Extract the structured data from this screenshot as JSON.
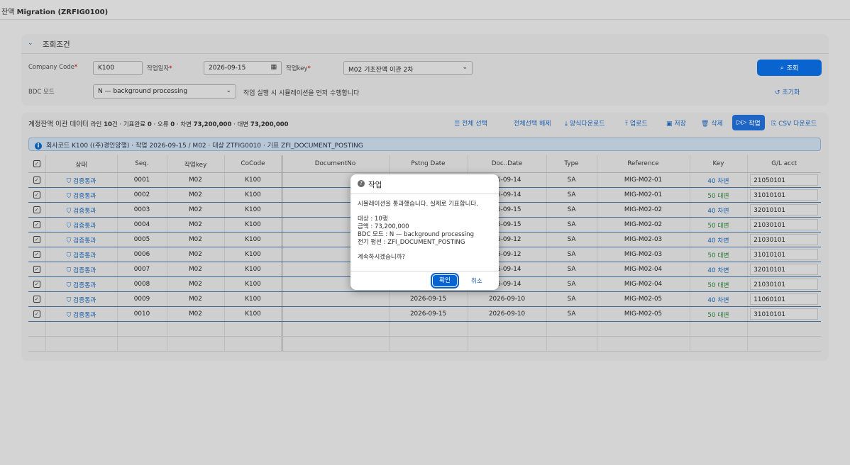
{
  "app": {
    "title_prefix": "잔액",
    "title_main": "Migration (ZRFIG0100)"
  },
  "filter": {
    "section_title": "조회조건",
    "company_code_label": "Company Code",
    "company_code_value": "K100",
    "work_date_label": "작업일자",
    "work_date_value": "2026-09-15",
    "work_key_label": "작업key",
    "work_key_value": "M02 기초잔액 이관 2차",
    "bdc_label": "BDC 모드",
    "bdc_value": "N — background processing",
    "note": "작업 실행 시 시뮬레이션을 먼저 수행합니다",
    "search_button": "조회",
    "reset_button": "초기화"
  },
  "table_bar": {
    "title": "계정잔액 이관 데이터",
    "sub_prefix": "라인",
    "lines": "10",
    "sub_mid1": "건 · 기표완료",
    "done": "0",
    "sub_mid2": "· 오류",
    "errors": "0",
    "sub_mid3": "· 차변",
    "debit": "73,200,000",
    "sub_mid4": "· 대변",
    "credit": "73,200,000",
    "select_all": "전체 선택",
    "deselect_all": "전체선택 해제",
    "download_template": "양식다운로드",
    "upload": "업로드",
    "save": "저장",
    "delete": "삭제",
    "execute": "작업",
    "csv_download": "CSV 다운로드"
  },
  "info": "회사코드 K100 ((주)경인앙행) · 작업 2026-09-15 / M02 · 대상 ZTFIG0010 · 기표 ZFI_DOCUMENT_POSTING",
  "columns": [
    "상태",
    "Seq.",
    "작업key",
    "CoCode",
    "DocumentNo",
    "Pstng Date",
    "Doc..Date",
    "Type",
    "Reference",
    "Key",
    "G/L acct"
  ],
  "rows": [
    {
      "status": "검증통과",
      "seq": "0001",
      "key": "M02",
      "co": "K100",
      "doc": "",
      "pdate": "",
      "ddate": "26-09-14",
      "type": "SA",
      "ref": "MIG-M02-01",
      "pk": "40 차변",
      "pkc": "k40",
      "gl": "21050101"
    },
    {
      "status": "검증통과",
      "seq": "0002",
      "key": "M02",
      "co": "K100",
      "doc": "",
      "pdate": "",
      "ddate": "26-09-14",
      "type": "SA",
      "ref": "MIG-M02-01",
      "pk": "50 대변",
      "pkc": "k50",
      "gl": "31010101"
    },
    {
      "status": "검증통과",
      "seq": "0003",
      "key": "M02",
      "co": "K100",
      "doc": "",
      "pdate": "",
      "ddate": "26-09-15",
      "type": "SA",
      "ref": "MIG-M02-02",
      "pk": "40 차변",
      "pkc": "k40",
      "gl": "32010101"
    },
    {
      "status": "검증통과",
      "seq": "0004",
      "key": "M02",
      "co": "K100",
      "doc": "",
      "pdate": "",
      "ddate": "26-09-15",
      "type": "SA",
      "ref": "MIG-M02-02",
      "pk": "50 대변",
      "pkc": "k50",
      "gl": "21030101"
    },
    {
      "status": "검증통과",
      "seq": "0005",
      "key": "M02",
      "co": "K100",
      "doc": "",
      "pdate": "",
      "ddate": "26-09-12",
      "type": "SA",
      "ref": "MIG-M02-03",
      "pk": "40 차변",
      "pkc": "k40",
      "gl": "21030101"
    },
    {
      "status": "검증통과",
      "seq": "0006",
      "key": "M02",
      "co": "K100",
      "doc": "",
      "pdate": "",
      "ddate": "26-09-12",
      "type": "SA",
      "ref": "MIG-M02-03",
      "pk": "50 대변",
      "pkc": "k50",
      "gl": "31010101"
    },
    {
      "status": "검증통과",
      "seq": "0007",
      "key": "M02",
      "co": "K100",
      "doc": "",
      "pdate": "",
      "ddate": "26-09-14",
      "type": "SA",
      "ref": "MIG-M02-04",
      "pk": "40 차변",
      "pkc": "k40",
      "gl": "32010101"
    },
    {
      "status": "검증통과",
      "seq": "0008",
      "key": "M02",
      "co": "K100",
      "doc": "",
      "pdate": "",
      "ddate": "26-09-14",
      "type": "SA",
      "ref": "MIG-M02-04",
      "pk": "50 대변",
      "pkc": "k50",
      "gl": "21030101"
    },
    {
      "status": "검증통과",
      "seq": "0009",
      "key": "M02",
      "co": "K100",
      "doc": "",
      "pdate": "2026-09-15",
      "ddate": "2026-09-10",
      "type": "SA",
      "ref": "MIG-M02-05",
      "pk": "40 차변",
      "pkc": "k40",
      "gl": "11060101"
    },
    {
      "status": "검증통과",
      "seq": "0010",
      "key": "M02",
      "co": "K100",
      "doc": "",
      "pdate": "2026-09-15",
      "ddate": "2026-09-10",
      "type": "SA",
      "ref": "MIG-M02-05",
      "pk": "50 대변",
      "pkc": "k50",
      "gl": "31010101"
    }
  ],
  "dialog": {
    "title": "작업",
    "line1": "시뮬레이션을 통과했습니다. 실제로 기표합니다.",
    "line2": "대상 : 10행",
    "line3": "금액 : 73,200,000",
    "line4": "BDC 모드 : N — background processing",
    "line5": "전기 펑션 : ZFI_DOCUMENT_POSTING",
    "line6": "계속하시겠습니까?",
    "ok": "확인",
    "cancel": "취소"
  }
}
